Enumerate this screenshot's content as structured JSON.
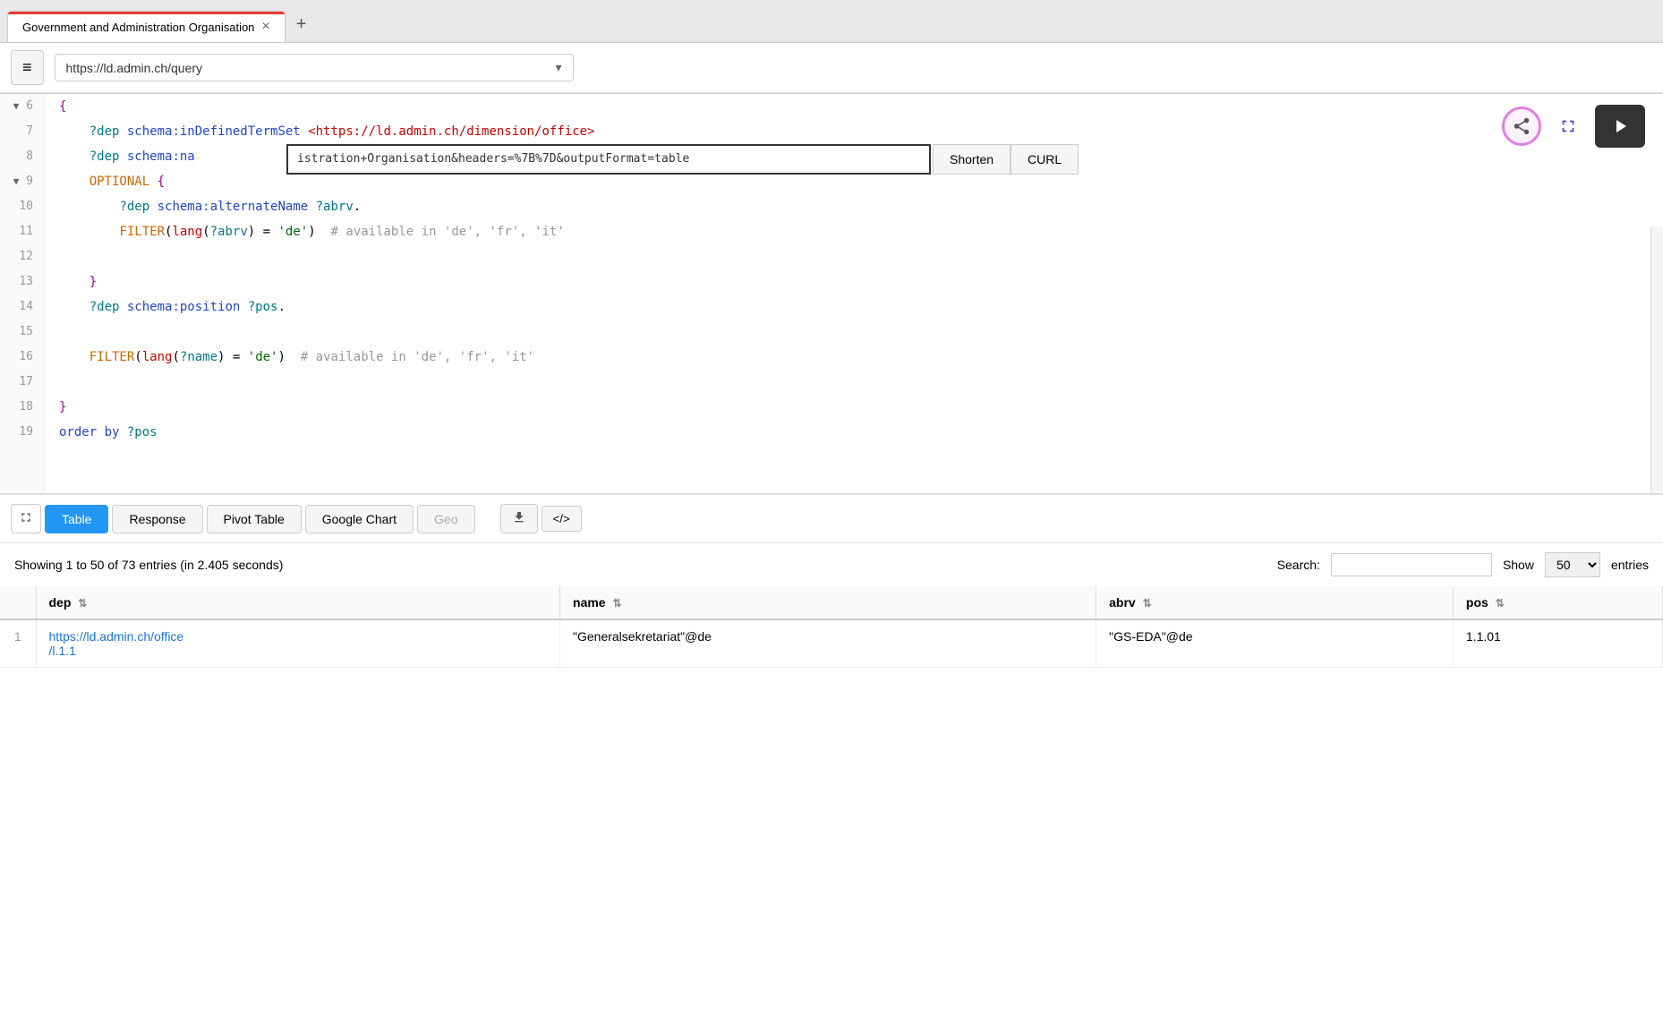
{
  "browser": {
    "tab_title": "Government and Administration Organisation",
    "tab_close": "×",
    "tab_add": "+",
    "url": "https://ld.admin.ch/query",
    "hamburger": "≡"
  },
  "editor": {
    "line_numbers": [
      "6",
      "7",
      "8",
      "9",
      "10",
      "11",
      "12",
      "13",
      "14",
      "15",
      "16",
      "17",
      "18",
      "19"
    ],
    "url_popup_text": "istration+Organisation&headers=%7B%7D&outputFormat=table",
    "shorten_label": "Shorten",
    "curl_label": "CURL"
  },
  "actions": {
    "share_icon": "share",
    "expand_icon": "⤢",
    "play_icon": "▶"
  },
  "results": {
    "expand_icon": "⤢",
    "tabs": [
      "Table",
      "Response",
      "Pivot Table",
      "Google Chart",
      "Geo"
    ],
    "active_tab": "Table",
    "download_icon": "⬇",
    "code_icon": "</>",
    "info_text": "Showing 1 to 50 of 73 entries (in 2.405 seconds)",
    "search_label": "Search:",
    "search_placeholder": "",
    "show_label": "Show",
    "show_value": "50",
    "entries_label": "entries",
    "columns": [
      "dep",
      "name",
      "abrv",
      "pos"
    ],
    "rows": [
      {
        "num": "1",
        "dep_link": "https://ld.admin.ch/office/l.1.1",
        "dep_text": "https://ld.admin.ch/office/l.1.1",
        "name": "\"Generalsekretariat\"@de",
        "abrv": "\"GS-EDA\"@de",
        "pos": "1.1.01"
      }
    ]
  },
  "code_lines": [
    {
      "num": "6",
      "arrow": "▼",
      "content": "{",
      "type": "plain"
    },
    {
      "num": "7",
      "content": "    ?dep schema:inDefinedTermSet <https://ld.admin.ch/dimension/office>",
      "type": "mixed7"
    },
    {
      "num": "8",
      "content": "    ?dep schema:na...",
      "type": "mixed8"
    },
    {
      "num": "9",
      "arrow": "▼",
      "content": "    OPTIONAL {",
      "type": "optional"
    },
    {
      "num": "10",
      "content": "        ?dep schema:alternateName ?abrv.",
      "type": "mixed10"
    },
    {
      "num": "11",
      "content": "        FILTER(lang(?abrv) = 'de')  # available in 'de', 'fr', 'it'",
      "type": "mixed11"
    },
    {
      "num": "12",
      "content": "",
      "type": "plain"
    },
    {
      "num": "13",
      "content": "    }",
      "type": "plain"
    },
    {
      "num": "14",
      "content": "    ?dep schema:position ?pos.",
      "type": "mixed14"
    },
    {
      "num": "15",
      "content": "",
      "type": "plain"
    },
    {
      "num": "16",
      "content": "    FILTER(lang(?name) = 'de')  # available in 'de', 'fr', 'it'",
      "type": "mixed16"
    },
    {
      "num": "17",
      "content": "",
      "type": "plain"
    },
    {
      "num": "18",
      "content": "}",
      "type": "plain"
    },
    {
      "num": "19",
      "content": "order by ?pos",
      "type": "mixed19"
    }
  ]
}
